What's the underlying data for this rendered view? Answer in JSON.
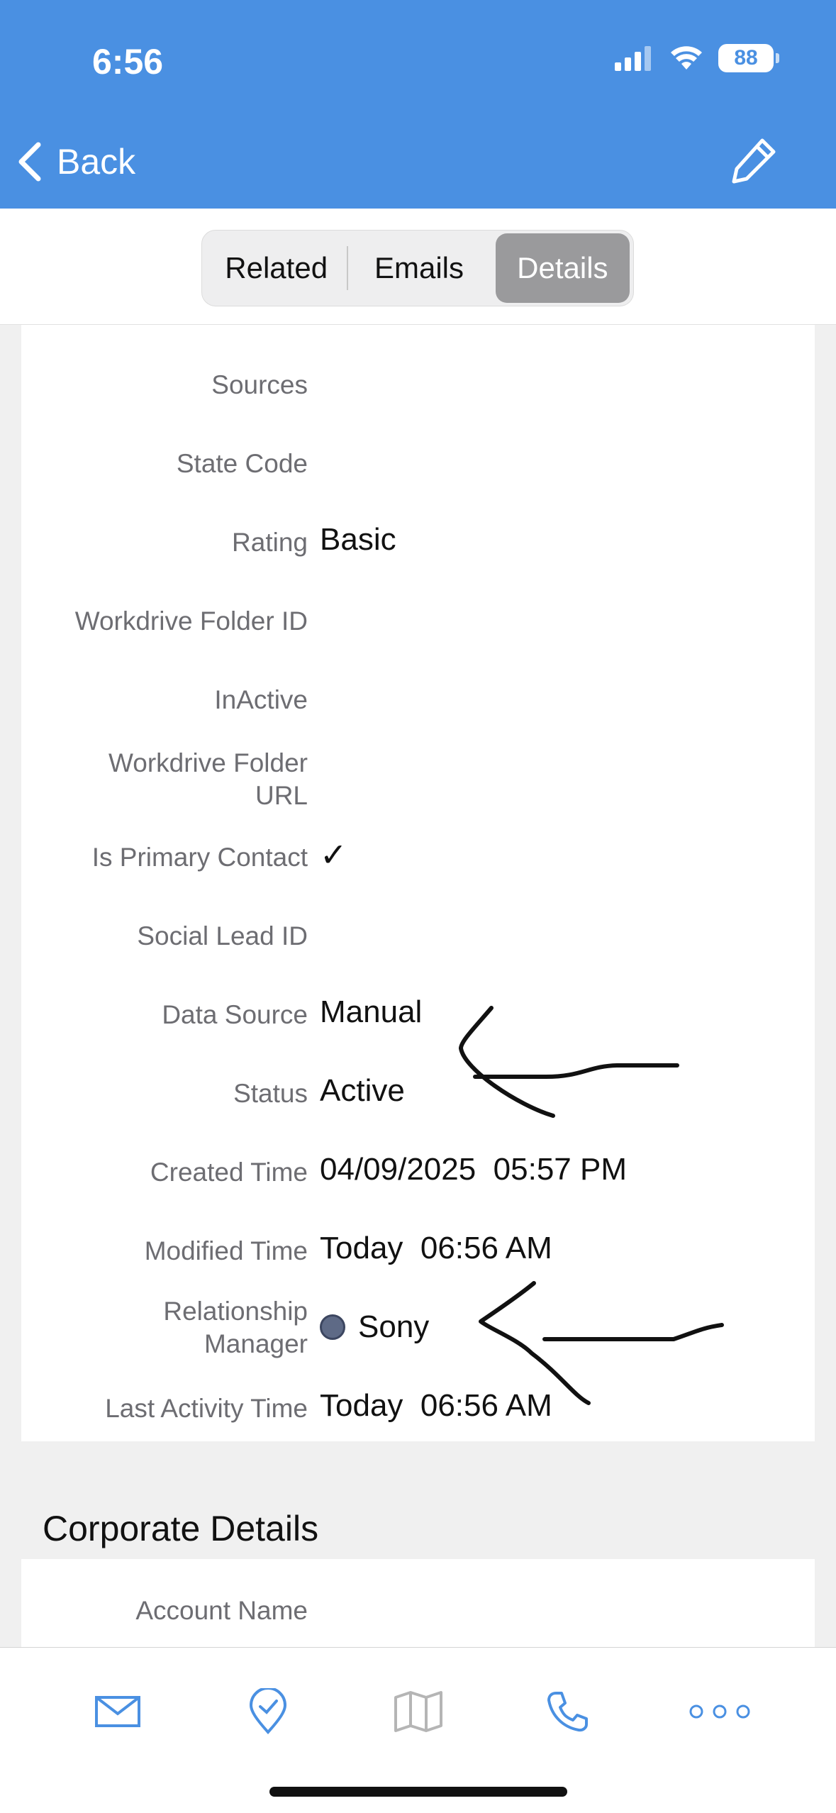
{
  "status_bar": {
    "time": "6:56",
    "battery": "88"
  },
  "nav": {
    "back_label": "Back"
  },
  "segments": {
    "related": "Related",
    "emails": "Emails",
    "details": "Details",
    "selected": "Details"
  },
  "fields": [
    {
      "label": "Sources",
      "value": ""
    },
    {
      "label": "State Code",
      "value": ""
    },
    {
      "label": "Rating",
      "value": "Basic"
    },
    {
      "label": "Workdrive Folder ID",
      "value": ""
    },
    {
      "label": "InActive",
      "value": ""
    },
    {
      "label": "Workdrive Folder URL",
      "value": ""
    },
    {
      "label": "Is Primary Contact",
      "value": "✓"
    },
    {
      "label": "Social Lead ID",
      "value": ""
    },
    {
      "label": "Data Source",
      "value": "Manual"
    },
    {
      "label": "Status",
      "value": "Active"
    },
    {
      "label": "Created Time",
      "value": "04/09/2025  05:57 PM"
    },
    {
      "label": "Modified Time",
      "value": "Today  06:56 AM"
    },
    {
      "label": "Relationship Manager",
      "value": "Sony"
    },
    {
      "label": "Last Activity Time",
      "value": "Today  06:56 AM"
    }
  ],
  "corporate": {
    "title": "Corporate Details",
    "account_name_label": "Account Name"
  },
  "tab_bar": {
    "icons": [
      "mail-icon",
      "checkin-icon",
      "map-icon",
      "phone-icon",
      "more-icon"
    ],
    "accent": "#4a90e2"
  },
  "colors": {
    "header": "#4a90e2",
    "label": "#6d6d72",
    "selected_segment": "#9a9a9c"
  }
}
